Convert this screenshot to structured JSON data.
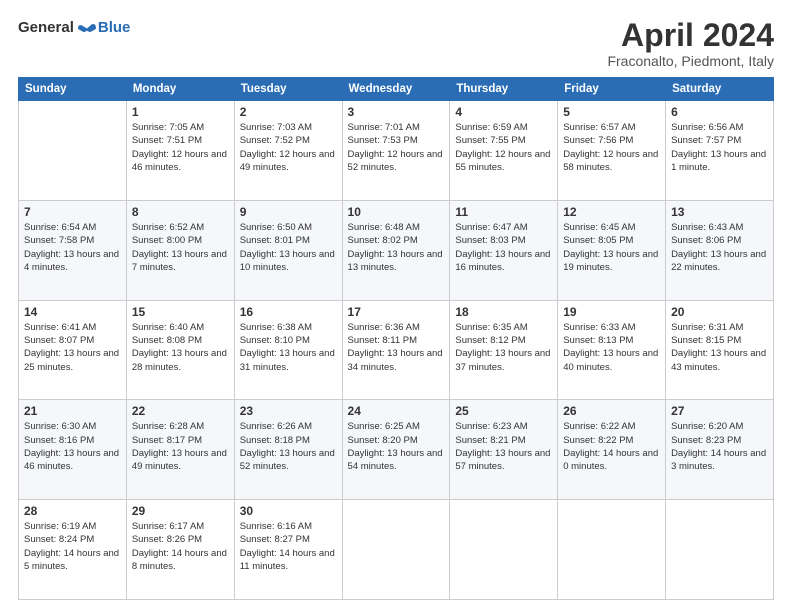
{
  "logo": {
    "general": "General",
    "blue": "Blue"
  },
  "header": {
    "title": "April 2024",
    "subtitle": "Fraconalto, Piedmont, Italy"
  },
  "weekdays": [
    "Sunday",
    "Monday",
    "Tuesday",
    "Wednesday",
    "Thursday",
    "Friday",
    "Saturday"
  ],
  "weeks": [
    [
      {
        "day": "",
        "sunrise": "",
        "sunset": "",
        "daylight": ""
      },
      {
        "day": "1",
        "sunrise": "Sunrise: 7:05 AM",
        "sunset": "Sunset: 7:51 PM",
        "daylight": "Daylight: 12 hours and 46 minutes."
      },
      {
        "day": "2",
        "sunrise": "Sunrise: 7:03 AM",
        "sunset": "Sunset: 7:52 PM",
        "daylight": "Daylight: 12 hours and 49 minutes."
      },
      {
        "day": "3",
        "sunrise": "Sunrise: 7:01 AM",
        "sunset": "Sunset: 7:53 PM",
        "daylight": "Daylight: 12 hours and 52 minutes."
      },
      {
        "day": "4",
        "sunrise": "Sunrise: 6:59 AM",
        "sunset": "Sunset: 7:55 PM",
        "daylight": "Daylight: 12 hours and 55 minutes."
      },
      {
        "day": "5",
        "sunrise": "Sunrise: 6:57 AM",
        "sunset": "Sunset: 7:56 PM",
        "daylight": "Daylight: 12 hours and 58 minutes."
      },
      {
        "day": "6",
        "sunrise": "Sunrise: 6:56 AM",
        "sunset": "Sunset: 7:57 PM",
        "daylight": "Daylight: 13 hours and 1 minute."
      }
    ],
    [
      {
        "day": "7",
        "sunrise": "Sunrise: 6:54 AM",
        "sunset": "Sunset: 7:58 PM",
        "daylight": "Daylight: 13 hours and 4 minutes."
      },
      {
        "day": "8",
        "sunrise": "Sunrise: 6:52 AM",
        "sunset": "Sunset: 8:00 PM",
        "daylight": "Daylight: 13 hours and 7 minutes."
      },
      {
        "day": "9",
        "sunrise": "Sunrise: 6:50 AM",
        "sunset": "Sunset: 8:01 PM",
        "daylight": "Daylight: 13 hours and 10 minutes."
      },
      {
        "day": "10",
        "sunrise": "Sunrise: 6:48 AM",
        "sunset": "Sunset: 8:02 PM",
        "daylight": "Daylight: 13 hours and 13 minutes."
      },
      {
        "day": "11",
        "sunrise": "Sunrise: 6:47 AM",
        "sunset": "Sunset: 8:03 PM",
        "daylight": "Daylight: 13 hours and 16 minutes."
      },
      {
        "day": "12",
        "sunrise": "Sunrise: 6:45 AM",
        "sunset": "Sunset: 8:05 PM",
        "daylight": "Daylight: 13 hours and 19 minutes."
      },
      {
        "day": "13",
        "sunrise": "Sunrise: 6:43 AM",
        "sunset": "Sunset: 8:06 PM",
        "daylight": "Daylight: 13 hours and 22 minutes."
      }
    ],
    [
      {
        "day": "14",
        "sunrise": "Sunrise: 6:41 AM",
        "sunset": "Sunset: 8:07 PM",
        "daylight": "Daylight: 13 hours and 25 minutes."
      },
      {
        "day": "15",
        "sunrise": "Sunrise: 6:40 AM",
        "sunset": "Sunset: 8:08 PM",
        "daylight": "Daylight: 13 hours and 28 minutes."
      },
      {
        "day": "16",
        "sunrise": "Sunrise: 6:38 AM",
        "sunset": "Sunset: 8:10 PM",
        "daylight": "Daylight: 13 hours and 31 minutes."
      },
      {
        "day": "17",
        "sunrise": "Sunrise: 6:36 AM",
        "sunset": "Sunset: 8:11 PM",
        "daylight": "Daylight: 13 hours and 34 minutes."
      },
      {
        "day": "18",
        "sunrise": "Sunrise: 6:35 AM",
        "sunset": "Sunset: 8:12 PM",
        "daylight": "Daylight: 13 hours and 37 minutes."
      },
      {
        "day": "19",
        "sunrise": "Sunrise: 6:33 AM",
        "sunset": "Sunset: 8:13 PM",
        "daylight": "Daylight: 13 hours and 40 minutes."
      },
      {
        "day": "20",
        "sunrise": "Sunrise: 6:31 AM",
        "sunset": "Sunset: 8:15 PM",
        "daylight": "Daylight: 13 hours and 43 minutes."
      }
    ],
    [
      {
        "day": "21",
        "sunrise": "Sunrise: 6:30 AM",
        "sunset": "Sunset: 8:16 PM",
        "daylight": "Daylight: 13 hours and 46 minutes."
      },
      {
        "day": "22",
        "sunrise": "Sunrise: 6:28 AM",
        "sunset": "Sunset: 8:17 PM",
        "daylight": "Daylight: 13 hours and 49 minutes."
      },
      {
        "day": "23",
        "sunrise": "Sunrise: 6:26 AM",
        "sunset": "Sunset: 8:18 PM",
        "daylight": "Daylight: 13 hours and 52 minutes."
      },
      {
        "day": "24",
        "sunrise": "Sunrise: 6:25 AM",
        "sunset": "Sunset: 8:20 PM",
        "daylight": "Daylight: 13 hours and 54 minutes."
      },
      {
        "day": "25",
        "sunrise": "Sunrise: 6:23 AM",
        "sunset": "Sunset: 8:21 PM",
        "daylight": "Daylight: 13 hours and 57 minutes."
      },
      {
        "day": "26",
        "sunrise": "Sunrise: 6:22 AM",
        "sunset": "Sunset: 8:22 PM",
        "daylight": "Daylight: 14 hours and 0 minutes."
      },
      {
        "day": "27",
        "sunrise": "Sunrise: 6:20 AM",
        "sunset": "Sunset: 8:23 PM",
        "daylight": "Daylight: 14 hours and 3 minutes."
      }
    ],
    [
      {
        "day": "28",
        "sunrise": "Sunrise: 6:19 AM",
        "sunset": "Sunset: 8:24 PM",
        "daylight": "Daylight: 14 hours and 5 minutes."
      },
      {
        "day": "29",
        "sunrise": "Sunrise: 6:17 AM",
        "sunset": "Sunset: 8:26 PM",
        "daylight": "Daylight: 14 hours and 8 minutes."
      },
      {
        "day": "30",
        "sunrise": "Sunrise: 6:16 AM",
        "sunset": "Sunset: 8:27 PM",
        "daylight": "Daylight: 14 hours and 11 minutes."
      },
      {
        "day": "",
        "sunrise": "",
        "sunset": "",
        "daylight": ""
      },
      {
        "day": "",
        "sunrise": "",
        "sunset": "",
        "daylight": ""
      },
      {
        "day": "",
        "sunrise": "",
        "sunset": "",
        "daylight": ""
      },
      {
        "day": "",
        "sunrise": "",
        "sunset": "",
        "daylight": ""
      }
    ]
  ]
}
